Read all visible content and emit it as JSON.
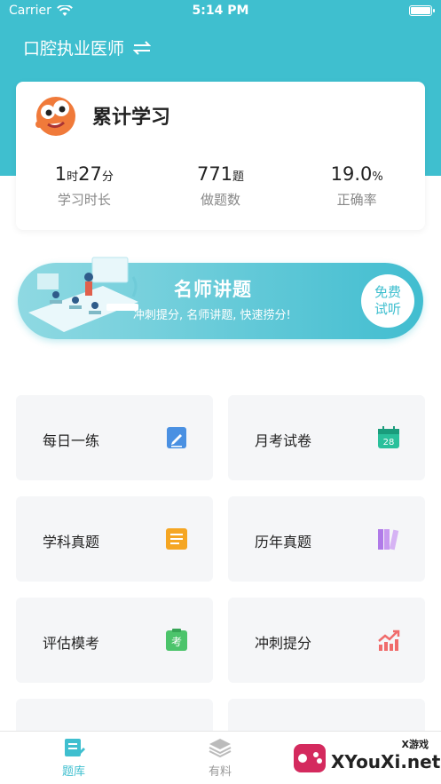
{
  "statusbar": {
    "carrier": "Carrier",
    "time": "5:14 PM"
  },
  "header": {
    "title": "口腔执业医师"
  },
  "summary": {
    "title": "累计学习",
    "stats": [
      {
        "num_a": "1",
        "unit_a": "时",
        "num_b": "27",
        "unit_b": "分",
        "label": "学习时长"
      },
      {
        "num": "771",
        "unit": "题",
        "label": "做题数"
      },
      {
        "num": "19.0",
        "unit": "%",
        "label": "正确率"
      }
    ]
  },
  "banner": {
    "title": "名师讲题",
    "subtitle": "冲刺提分, 名师讲题, 快速捞分!",
    "trial_line1": "免费",
    "trial_line2": "试听"
  },
  "tiles": [
    {
      "label": "每日一练",
      "icon": "edit-note-icon",
      "color": "#4a90e2"
    },
    {
      "label": "月考试卷",
      "icon": "calendar-icon",
      "color": "#2ac09b",
      "icon_text": "28"
    },
    {
      "label": "学科真题",
      "icon": "notepad-icon",
      "color": "#f5a623"
    },
    {
      "label": "历年真题",
      "icon": "books-icon",
      "color": "#b07ae8"
    },
    {
      "label": "评估模考",
      "icon": "exam-icon",
      "color": "#4cc46b",
      "icon_text": "考"
    },
    {
      "label": "冲刺提分",
      "icon": "trend-up-icon",
      "color": "#f06b6b"
    }
  ],
  "tabbar": [
    {
      "label": "题库",
      "active": true
    },
    {
      "label": "有料",
      "active": false
    }
  ],
  "watermark": {
    "brand": "XYouXi.net",
    "small": "X游戏"
  },
  "colors": {
    "primary": "#3fbfcf"
  }
}
